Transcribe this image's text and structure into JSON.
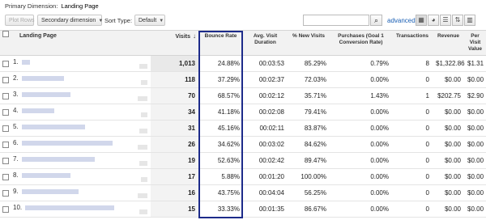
{
  "primary_dimension": {
    "label": "Primary Dimension:",
    "value": "Landing Page"
  },
  "toolbar": {
    "plot_rows": "Plot Rows",
    "secondary_dimension": "Secondary dimension",
    "sort_type_label": "Sort Type:",
    "sort_type_value": "Default",
    "search_placeholder": "",
    "advanced": "advanced",
    "view_icons": [
      "grid-view-icon",
      "pie-view-icon",
      "performance-view-icon",
      "comparison-view-icon",
      "pivot-view-icon"
    ]
  },
  "table": {
    "headers": {
      "landing_page": "Landing Page",
      "visits": "Visits",
      "bounce_rate": "Bounce Rate",
      "avg_visit_duration": "Avg. Visit Duration",
      "pct_new_visits": "% New Visits",
      "purchases": "Purchases (Goal 1 Conversion Rate)",
      "transactions": "Transactions",
      "revenue": "Revenue",
      "per_visit_value": "Per Visit Value"
    },
    "rows": [
      {
        "num": "1.",
        "visits": "1,013",
        "bounce": "24.88%",
        "duration": "00:03:53",
        "new_visits": "85.29%",
        "purchases": "0.79%",
        "transactions": "8",
        "revenue": "$1,322.86",
        "per_visit": "$1.31"
      },
      {
        "num": "2.",
        "visits": "118",
        "bounce": "37.29%",
        "duration": "00:02:37",
        "new_visits": "72.03%",
        "purchases": "0.00%",
        "transactions": "0",
        "revenue": "$0.00",
        "per_visit": "$0.00"
      },
      {
        "num": "3.",
        "visits": "70",
        "bounce": "68.57%",
        "duration": "00:02:12",
        "new_visits": "35.71%",
        "purchases": "1.43%",
        "transactions": "1",
        "revenue": "$202.75",
        "per_visit": "$2.90"
      },
      {
        "num": "4.",
        "visits": "34",
        "bounce": "41.18%",
        "duration": "00:02:08",
        "new_visits": "79.41%",
        "purchases": "0.00%",
        "transactions": "0",
        "revenue": "$0.00",
        "per_visit": "$0.00"
      },
      {
        "num": "5.",
        "visits": "31",
        "bounce": "45.16%",
        "duration": "00:02:11",
        "new_visits": "83.87%",
        "purchases": "0.00%",
        "transactions": "0",
        "revenue": "$0.00",
        "per_visit": "$0.00"
      },
      {
        "num": "6.",
        "visits": "26",
        "bounce": "34.62%",
        "duration": "00:03:02",
        "new_visits": "84.62%",
        "purchases": "0.00%",
        "transactions": "0",
        "revenue": "$0.00",
        "per_visit": "$0.00"
      },
      {
        "num": "7.",
        "visits": "19",
        "bounce": "52.63%",
        "duration": "00:02:42",
        "new_visits": "89.47%",
        "purchases": "0.00%",
        "transactions": "0",
        "revenue": "$0.00",
        "per_visit": "$0.00"
      },
      {
        "num": "8.",
        "visits": "17",
        "bounce": "5.88%",
        "duration": "00:01:20",
        "new_visits": "100.00%",
        "purchases": "0.00%",
        "transactions": "0",
        "revenue": "$0.00",
        "per_visit": "$0.00"
      },
      {
        "num": "9.",
        "visits": "16",
        "bounce": "43.75%",
        "duration": "00:04:04",
        "new_visits": "56.25%",
        "purchases": "0.00%",
        "transactions": "0",
        "revenue": "$0.00",
        "per_visit": "$0.00"
      },
      {
        "num": "10.",
        "visits": "15",
        "bounce": "33.33%",
        "duration": "00:01:35",
        "new_visits": "86.67%",
        "purchases": "0.00%",
        "transactions": "0",
        "revenue": "$0.00",
        "per_visit": "$0.00"
      }
    ]
  },
  "colors": {
    "highlight_border": "#1d2b8a",
    "link": "#1a5fb4"
  }
}
